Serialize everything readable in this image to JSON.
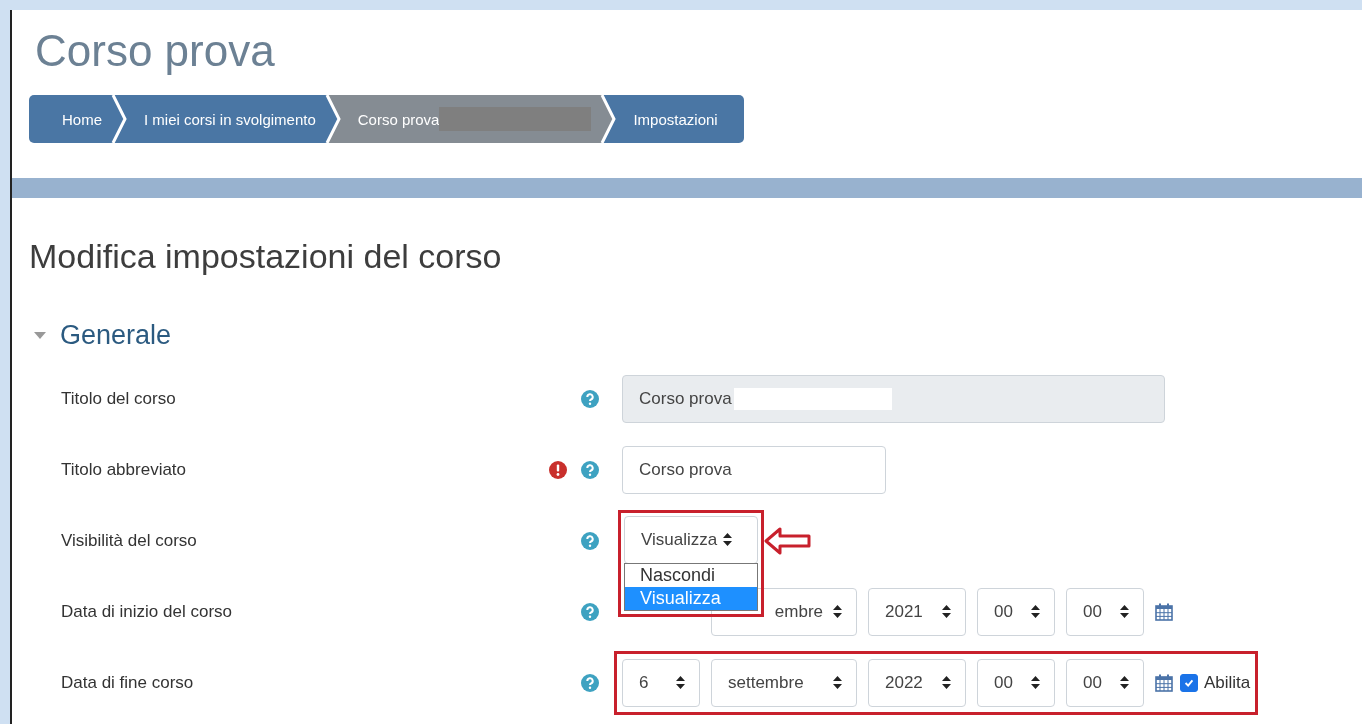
{
  "page_title": "Corso prova",
  "breadcrumb": [
    {
      "label": "Home",
      "current": false,
      "redacted": false
    },
    {
      "label": "I miei corsi in svolgimento",
      "current": false,
      "redacted": false
    },
    {
      "label": "Corso prova",
      "current": true,
      "redacted": true
    },
    {
      "label": "Impostazioni",
      "current": false,
      "redacted": false
    }
  ],
  "heading": "Modifica impostazioni del corso",
  "fieldset": {
    "title": "Generale",
    "expanded": true
  },
  "fields": [
    {
      "kind": "text",
      "label": "Titolo del corso",
      "required": false,
      "disabled": true,
      "redacted": true,
      "value": "Corso prova"
    },
    {
      "kind": "text",
      "label": "Titolo abbreviato",
      "required": true,
      "disabled": false,
      "redacted": false,
      "value": "Corso prova"
    },
    {
      "kind": "select",
      "label": "Visibilità del corso",
      "required": false,
      "highlighted": true,
      "pointer_arrow": true,
      "value": "Visualizza",
      "options": [
        {
          "label": "Nascondi",
          "selected": false
        },
        {
          "label": "Visualizza",
          "selected": true
        }
      ]
    },
    {
      "kind": "date",
      "label": "Data di inizio del corso",
      "required": false,
      "selects": [
        {
          "kind": "month",
          "value": "embre"
        },
        {
          "kind": "year",
          "value": "2021"
        },
        {
          "kind": "hour",
          "value": "00"
        },
        {
          "kind": "minute",
          "value": "00"
        }
      ]
    },
    {
      "kind": "date",
      "label": "Data di fine corso",
      "required": false,
      "highlighted": true,
      "selects": [
        {
          "kind": "day",
          "value": "6"
        },
        {
          "kind": "month",
          "value": "settembre"
        },
        {
          "kind": "year",
          "value": "2022"
        },
        {
          "kind": "hour",
          "value": "00"
        },
        {
          "kind": "minute",
          "value": "00"
        }
      ],
      "enable": {
        "label": "Abilita",
        "checked": true
      }
    }
  ]
}
